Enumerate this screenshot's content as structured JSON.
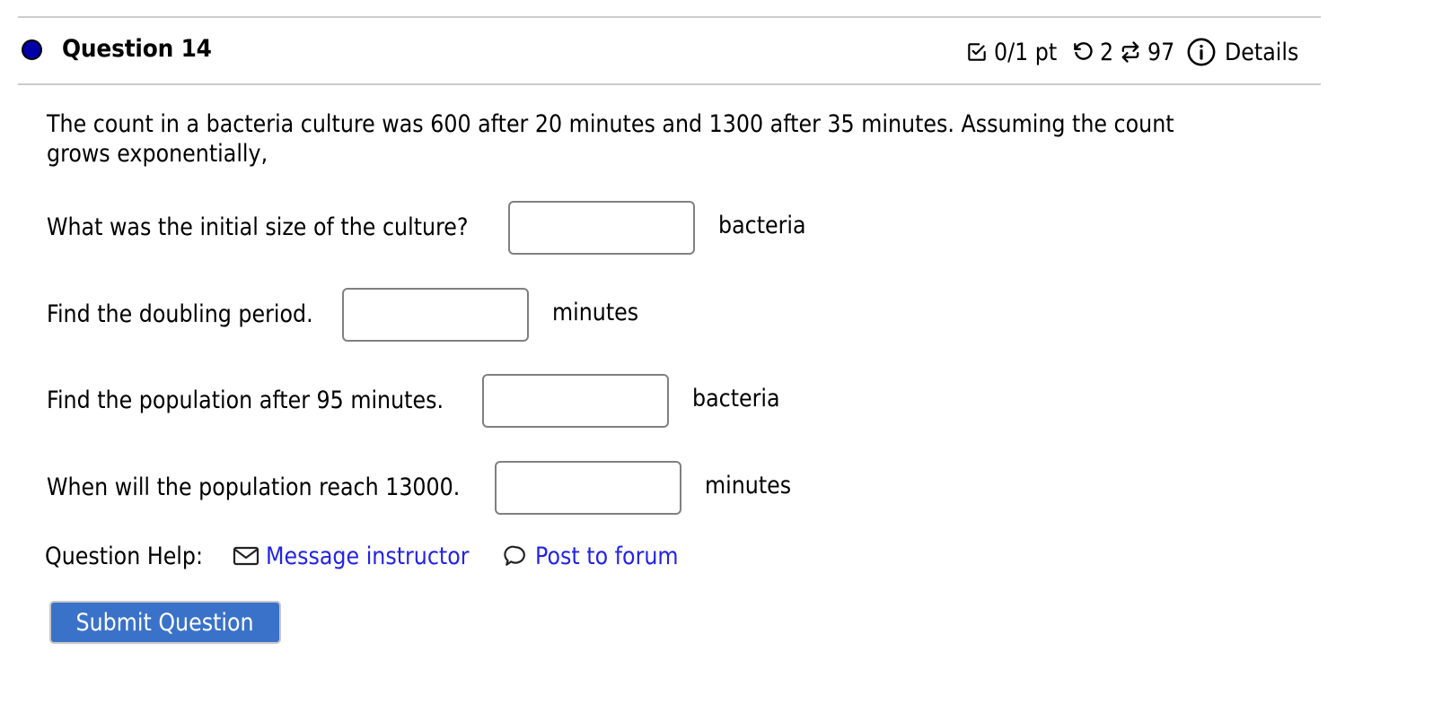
{
  "question": {
    "title": "Question 14",
    "status_color": "#0000a8",
    "score": "0/1 pt",
    "retries": "2",
    "attempts": "97",
    "details_label": "Details"
  },
  "prompt": {
    "line1": "The count in a bacteria culture was 600 after 20 minutes and 1300 after 35 minutes. Assuming the count",
    "line2": "grows exponentially,"
  },
  "parts": [
    {
      "label": "What was the initial size of the culture?",
      "value": "",
      "unit": "bacteria"
    },
    {
      "label": "Find the doubling period.",
      "value": "",
      "unit": "minutes"
    },
    {
      "label": "Find the population after 95 minutes.",
      "value": "",
      "unit": "bacteria"
    },
    {
      "label": "When will the population reach 13000.",
      "value": "",
      "unit": "minutes"
    }
  ],
  "help": {
    "label": "Question Help:",
    "message_instructor": "Message instructor",
    "post_to_forum": "Post to forum",
    "link_color": "#2323e6"
  },
  "submit": {
    "label": "Submit Question",
    "color": "#3a72c9"
  }
}
